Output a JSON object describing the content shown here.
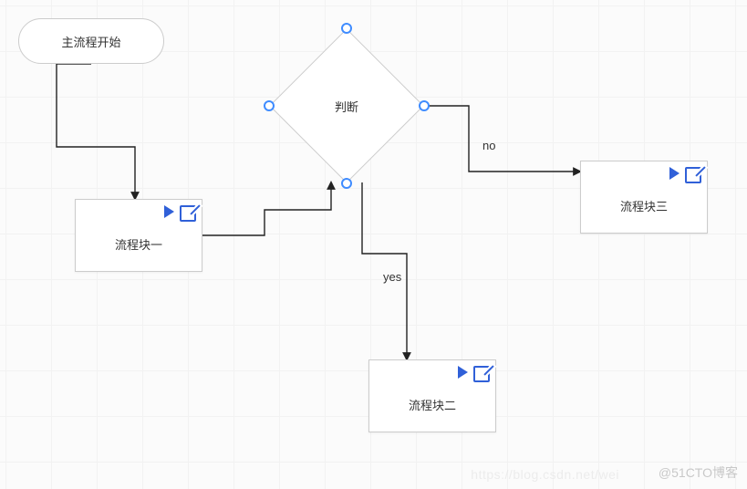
{
  "start": {
    "label": "主流程开始"
  },
  "decision": {
    "label": "判断"
  },
  "process1": {
    "label": "流程块一",
    "play_icon": "play-icon",
    "edit_icon": "edit-icon"
  },
  "process2": {
    "label": "流程块二",
    "play_icon": "play-icon",
    "edit_icon": "edit-icon"
  },
  "process3": {
    "label": "流程块三",
    "play_icon": "play-icon",
    "edit_icon": "edit-icon"
  },
  "edges": {
    "yes_label": "yes",
    "no_label": "no"
  },
  "watermark_primary": "@51CTO博客",
  "watermark_secondary": "https://blog.csdn.net/wei",
  "chart_data": {
    "type": "diagram",
    "nodes": [
      {
        "id": "start",
        "kind": "terminator",
        "label": "主流程开始",
        "selected": false
      },
      {
        "id": "p1",
        "kind": "process",
        "label": "流程块一",
        "selected": false
      },
      {
        "id": "decision",
        "kind": "decision",
        "label": "判断",
        "selected": true
      },
      {
        "id": "p2",
        "kind": "process",
        "label": "流程块二",
        "selected": false
      },
      {
        "id": "p3",
        "kind": "process",
        "label": "流程块三",
        "selected": false
      }
    ],
    "edges": [
      {
        "from": "start",
        "to": "p1",
        "label": null
      },
      {
        "from": "p1",
        "to": "decision",
        "label": null
      },
      {
        "from": "decision",
        "to": "p2",
        "label": "yes"
      },
      {
        "from": "decision",
        "to": "p3",
        "label": "no"
      }
    ]
  }
}
